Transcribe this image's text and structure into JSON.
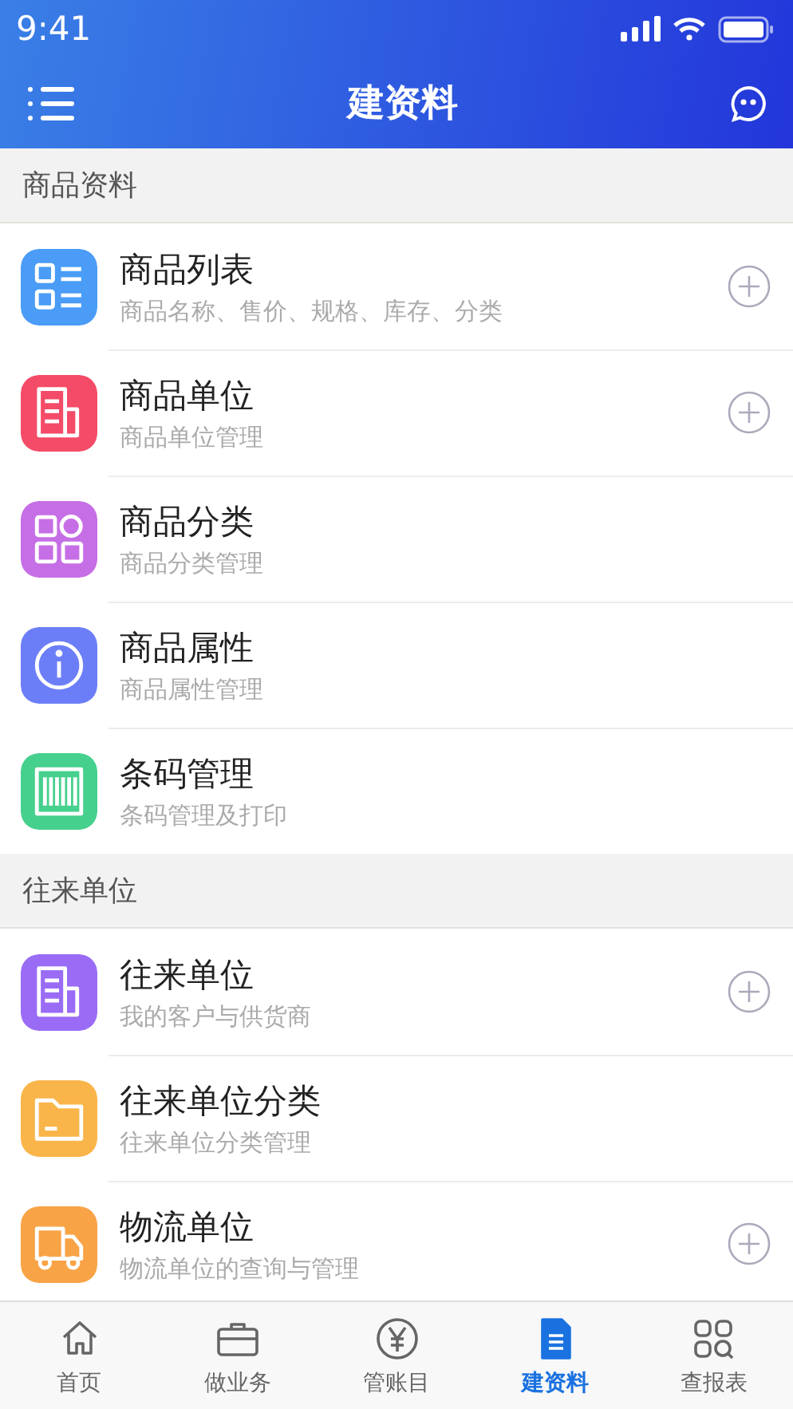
{
  "status_bar": {
    "time": "9:41"
  },
  "header": {
    "title": "建资料"
  },
  "sections": [
    {
      "title": "商品资料",
      "items": [
        {
          "kind": "list",
          "color": "#4a9cf6",
          "title": "商品列表",
          "subtitle": "商品名称、售价、规格、库存、分类",
          "add": true
        },
        {
          "kind": "doc",
          "color": "#f44b68",
          "title": "商品单位",
          "subtitle": "商品单位管理",
          "add": true
        },
        {
          "kind": "grid",
          "color": "#c66ee6",
          "title": "商品分类",
          "subtitle": "商品分类管理",
          "add": false
        },
        {
          "kind": "info",
          "color": "#6c7ef7",
          "title": "商品属性",
          "subtitle": "商品属性管理",
          "add": false
        },
        {
          "kind": "barcode",
          "color": "#45d08d",
          "title": "条码管理",
          "subtitle": "条码管理及打印",
          "add": false
        }
      ]
    },
    {
      "title": "往来单位",
      "items": [
        {
          "kind": "doc",
          "color": "#9a6cf5",
          "title": "往来单位",
          "subtitle": "我的客户与供货商",
          "add": true
        },
        {
          "kind": "folder",
          "color": "#f9b54a",
          "title": "往来单位分类",
          "subtitle": "往来单位分类管理",
          "add": false
        },
        {
          "kind": "truck",
          "color": "#f8a346",
          "title": "物流单位",
          "subtitle": "物流单位的查询与管理",
          "add": true
        }
      ]
    }
  ],
  "tabs": [
    {
      "kind": "home",
      "label": "首页",
      "selected": false
    },
    {
      "kind": "briefcase",
      "label": "做业务",
      "selected": false
    },
    {
      "kind": "yen",
      "label": "管账目",
      "selected": false
    },
    {
      "kind": "document",
      "label": "建资料",
      "selected": true
    },
    {
      "kind": "apps",
      "label": "查报表",
      "selected": false
    }
  ]
}
